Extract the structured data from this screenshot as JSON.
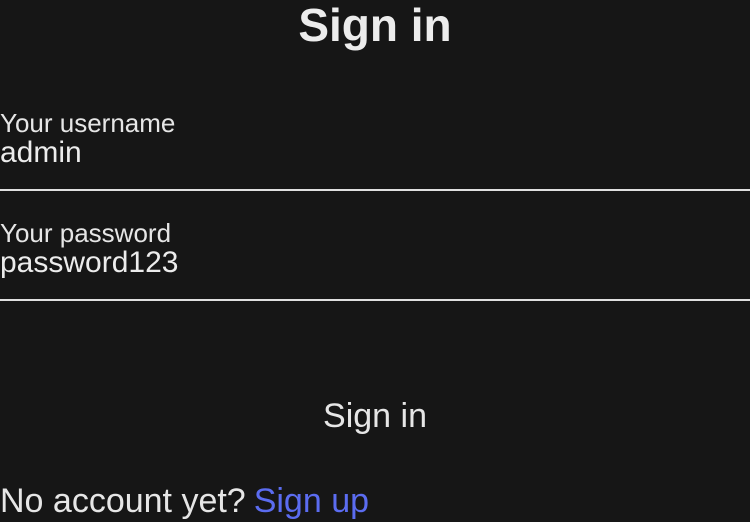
{
  "title": "Sign in",
  "form": {
    "username": {
      "label": "Your username",
      "value": "admin"
    },
    "password": {
      "label": "Your password",
      "value": "password123"
    },
    "submit_label": "Sign in"
  },
  "footer": {
    "prompt": "No account yet?",
    "link_label": "Sign up"
  },
  "colors": {
    "background": "#161616",
    "text": "#e6e6e6",
    "link": "#5b6cf0",
    "field_underline": "#e0e0e0"
  }
}
